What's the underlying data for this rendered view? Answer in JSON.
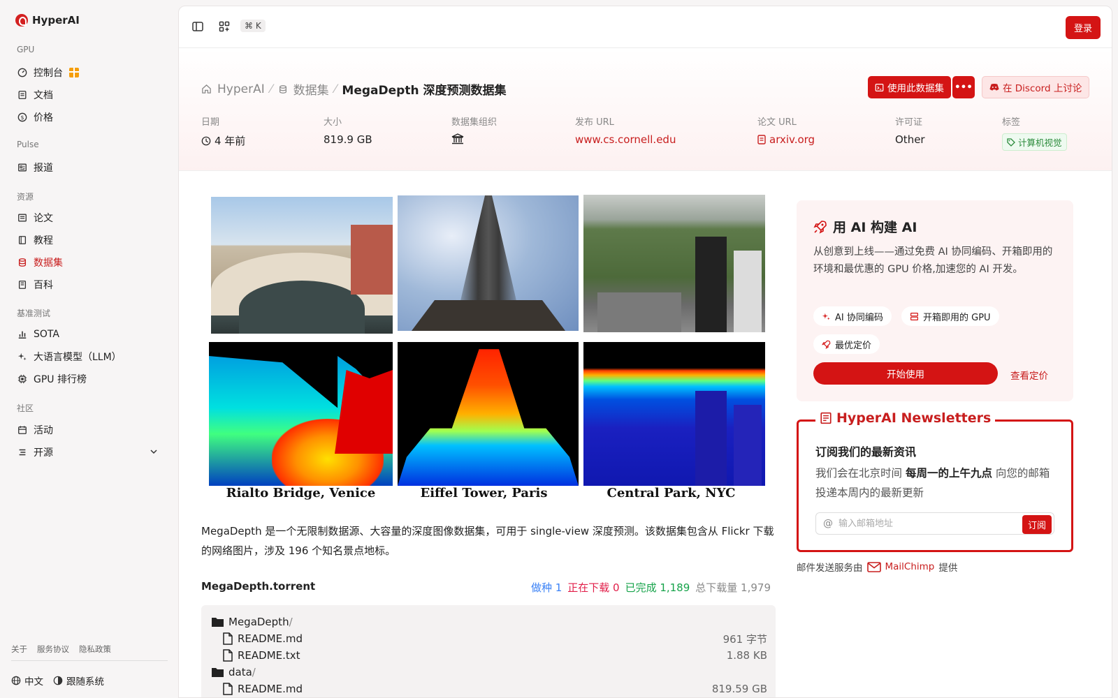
{
  "brand": {
    "name": "HyperAI"
  },
  "sidebar": {
    "sections": {
      "gpu": "GPU",
      "pulse": "Pulse",
      "resources": "资源",
      "benchmark": "基准测试",
      "community": "社区"
    },
    "items": {
      "console": "控制台",
      "docs": "文档",
      "pricing": "价格",
      "reports": "报道",
      "papers": "论文",
      "tutorials": "教程",
      "datasets": "数据集",
      "wiki": "百科",
      "sota": "SOTA",
      "llm": "大语言模型（LLM）",
      "gpu_rank": "GPU 排行榜",
      "events": "活动",
      "opensource": "开源"
    },
    "footer_links": [
      "关于",
      "服务协议",
      "隐私政策"
    ],
    "language": "中文",
    "theme": "跟随系统"
  },
  "topbar": {
    "shortcut": "⌘ K",
    "login": "登录"
  },
  "breadcrumb": {
    "home": "HyperAI",
    "datasets": "数据集",
    "current": "MegaDepth 深度预测数据集"
  },
  "actions": {
    "use_dataset": "使用此数据集",
    "more": "•••",
    "discord": "在 Discord 上讨论"
  },
  "meta": {
    "date_label": "日期",
    "date_value": "4 年前",
    "size_label": "大小",
    "size_value": "819.9 GB",
    "org_label": "数据集组织",
    "url_label": "发布 URL",
    "url_value": "www.cs.cornell.edu",
    "paper_label": "论文 URL",
    "paper_value": "arxiv.org",
    "license_label": "许可证",
    "license_value": "Other",
    "tags_label": "标签",
    "tag_value": "计算机视觉"
  },
  "collage": {
    "captions": [
      "Rialto Bridge, Venice",
      "Eiffel Tower, Paris",
      "Central Park, NYC"
    ]
  },
  "description": "MegaDepth 是一个无限制数据源、大容量的深度图像数据集，可用于 single-view 深度预测。该数据集包含从 Flickr 下载的网络图片，涉及 196 个知名景点地标。",
  "torrent": {
    "title": "MegaDepth.torrent",
    "seeding": "做种 1",
    "downloading": "正在下载 0",
    "completed": "已完成 1,189",
    "total": "总下载量 1,979",
    "files": [
      {
        "name": "MegaDepth",
        "slash": "/",
        "size": ""
      },
      {
        "name": "README.md",
        "size": "961 字节"
      },
      {
        "name": "README.txt",
        "size": "1.88 KB"
      },
      {
        "name": "data",
        "slash": "/",
        "size": ""
      },
      {
        "name": "README.md",
        "size": "819.59 GB"
      }
    ]
  },
  "promo": {
    "title": "用 AI 构建 AI",
    "text": "从创意到上线——通过免费 AI 协同编码、开箱即用的环境和最优惠的 GPU 价格,加速您的 AI 开发。",
    "chips": [
      "AI 协同编码",
      "开箱即用的 GPU",
      "最优定价"
    ],
    "start": "开始使用",
    "pricing": "查看定价"
  },
  "newsletter": {
    "title": "HyperAI Newsletters",
    "heading": "订阅我们的最新资讯",
    "text_pre": "我们会在北京时间 ",
    "text_bold": "每周一的上午九点",
    "text_post": " 向您的邮箱投递本周内的最新更新",
    "placeholder": "输入邮箱地址",
    "subscribe": "订阅"
  },
  "mailer": {
    "pre": "邮件发送服务由",
    "name": "MailChimp",
    "post": "提供"
  },
  "colors": {
    "accent": "#d41414",
    "seed": "#3b82f6",
    "downloading": "#e11d48",
    "completed": "#16a34a"
  }
}
